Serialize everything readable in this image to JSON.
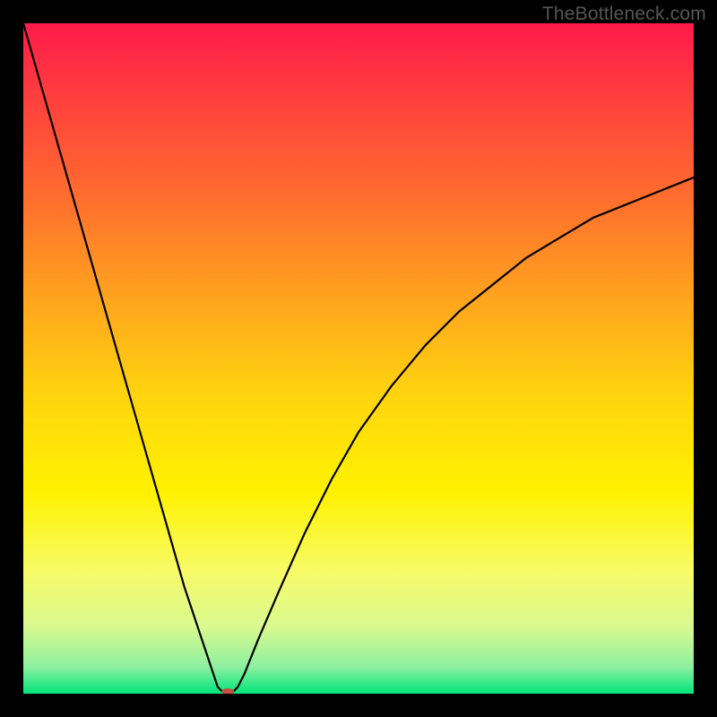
{
  "watermark": "TheBottleneck.com",
  "chart_data": {
    "type": "line",
    "title": "",
    "xlabel": "",
    "ylabel": "",
    "xlim": [
      0,
      100
    ],
    "ylim": [
      0,
      100
    ],
    "grid": false,
    "legend": false,
    "background": {
      "type": "vertical-gradient",
      "stops": [
        {
          "pos": 0.0,
          "color": "#ff1a4a"
        },
        {
          "pos": 0.1,
          "color": "#ff3b3f"
        },
        {
          "pos": 0.25,
          "color": "#ff6a2f"
        },
        {
          "pos": 0.4,
          "color": "#ffa01f"
        },
        {
          "pos": 0.55,
          "color": "#ffd30f"
        },
        {
          "pos": 0.7,
          "color": "#fff200"
        },
        {
          "pos": 0.82,
          "color": "#f7fb6a"
        },
        {
          "pos": 0.9,
          "color": "#d9f98f"
        },
        {
          "pos": 0.96,
          "color": "#8ef0a0"
        },
        {
          "pos": 1.0,
          "color": "#00e57a"
        }
      ]
    },
    "series": [
      {
        "name": "bottleneck-curve",
        "color": "#000000",
        "width": 2.2,
        "x": [
          0,
          2,
          4,
          6,
          8,
          10,
          12,
          14,
          16,
          18,
          20,
          22,
          24,
          26,
          28,
          29,
          30,
          31,
          32,
          33,
          35,
          38,
          42,
          46,
          50,
          55,
          60,
          65,
          70,
          75,
          80,
          85,
          90,
          95,
          100
        ],
        "y": [
          100,
          93,
          86,
          79,
          72,
          65,
          58,
          51,
          44,
          37,
          30,
          23,
          16,
          10,
          4,
          1,
          0,
          0,
          1,
          3,
          8,
          15,
          24,
          32,
          39,
          46,
          52,
          57,
          61,
          65,
          68,
          71,
          73,
          75,
          77
        ]
      }
    ],
    "marker": {
      "name": "optimal-point",
      "x": 30.5,
      "y": 0,
      "color": "#c0543f",
      "rx": 7,
      "ry": 4
    }
  }
}
